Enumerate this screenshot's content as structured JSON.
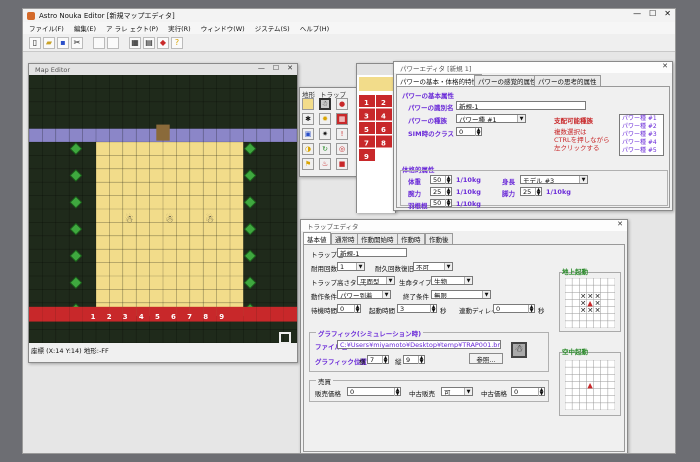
{
  "app": {
    "title": "Astro Nouka Editor [新規マップエディタ]",
    "menu": [
      "ファイル(F)",
      "編集(E)",
      "ア ラレ ェクト(P)",
      "実行(R)",
      "ウィンドウ(W)",
      "ジステム(S)",
      "ヘルプ(H)"
    ]
  },
  "map_editor": {
    "title": "Map Editor",
    "status": "座標 (X:14  Y:14) 地形:-FF",
    "trap_numbers": [
      "1",
      "2",
      "3",
      "4",
      "5",
      "6",
      "7",
      "8",
      "9"
    ]
  },
  "palette": {
    "tabs": [
      "地形",
      "トラップ"
    ]
  },
  "trap_list": {
    "numbers": [
      "1",
      "2",
      "3",
      "4",
      "5",
      "6",
      "7",
      "8",
      "9"
    ]
  },
  "unit_window": {
    "title": "パワーエディタ [新規 1]",
    "tabs": [
      "パワーの基本・体格的特性",
      "パワーの感覚的属性",
      "パワーの思考的属性"
    ],
    "basic_header": "パワーの基本属性",
    "name_label": "パワーの識別名",
    "name_value": "新規-1",
    "type_label": "パワーの種族",
    "type_value": "パワー種 #1",
    "sim_label": "SIM時のクラス",
    "sim_value": "0",
    "rule_header": "支配可能種族",
    "rule_note": [
      "複数選択は",
      "CTRLを押しながら",
      "左クリックする"
    ],
    "species": [
      "パワー種 #1",
      "パワー種 #2",
      "パワー種 #3",
      "パワー種 #4",
      "パワー種 #5"
    ],
    "phys_header": "体格的属性",
    "p1_label": "体重",
    "p1_value": "50",
    "p1_unit": "1/10kg",
    "p2_label": "腕力",
    "p2_value": "25",
    "p2_unit": "1/10kg",
    "p3_label": "羽根根",
    "p3_value": "50",
    "p3_unit": "1/10kg",
    "h_label": "身長",
    "h_value": "モデル #3",
    "leg_label": "脚力",
    "leg_value": "25",
    "leg_unit": "1/10kg"
  },
  "trap_window": {
    "title": "トラップエディタ",
    "tabs": [
      "基本値",
      "通常時",
      "作動開始時",
      "作動時",
      "作動後"
    ],
    "name_label": "トラップ名",
    "name_value": "新規-1",
    "dur_label": "耐用回数",
    "dur_value": "1",
    "rec_label": "耐久回数復旧",
    "rec_value": "不可",
    "height_label": "トラップ高さタイプ",
    "height_value": "平面型",
    "life_label": "生命タイプ",
    "life_value": "生物",
    "act_label": "動作条件",
    "act_value": "パワー到着",
    "end_label": "終了条件",
    "end_value": "無限",
    "wait_label": "待機時間",
    "wait_value": "0",
    "start_label": "起動時間",
    "start_value": "3",
    "sec1": "秒",
    "delay_label": "連動ディレイ",
    "delay_value": "0",
    "sec2": "秒",
    "gfx_header": "グラフィック(シミュレーション時)",
    "file_label": "ファイル名",
    "file_value": "C:¥Users¥miyamoto¥Desktop¥temp¥TRAP001.bmp",
    "pos_label": "グラフィック位置",
    "w_label": "横",
    "w_value": "7",
    "h_label": "縦",
    "h_value": "9",
    "ref_label": "参照...",
    "sale_header": "売買",
    "buy_label": "販売価格",
    "buy_value": "0",
    "used_label": "中古販売",
    "used_value": "可",
    "usedp_label": "中古価格",
    "usedp_value": "0",
    "ground_header": "地上起動",
    "air_header": "空中起動"
  },
  "colors": {
    "wall": "#1f2a1b",
    "floor": "#f2dc8a",
    "water": "#8b86c8",
    "trap": "#c8282a",
    "accent": "#6a2ad8"
  }
}
